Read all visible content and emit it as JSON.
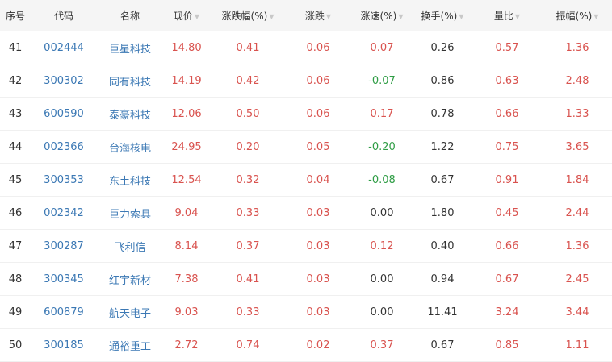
{
  "colors": {
    "up": "#d9534f",
    "down": "#2f9d45",
    "flat": "#333333",
    "link": "#3b78b4"
  },
  "headers": [
    {
      "key": "seq",
      "label": "序号",
      "sortable": false
    },
    {
      "key": "code",
      "label": "代码",
      "sortable": false
    },
    {
      "key": "name",
      "label": "名称",
      "sortable": false
    },
    {
      "key": "price",
      "label": "现价",
      "sortable": true
    },
    {
      "key": "chg_pct",
      "label": "涨跌幅(%)",
      "sortable": true
    },
    {
      "key": "chg",
      "label": "涨跌",
      "sortable": true
    },
    {
      "key": "speed",
      "label": "涨速(%)",
      "sortable": true
    },
    {
      "key": "turnover",
      "label": "换手(%)",
      "sortable": true
    },
    {
      "key": "vol_ratio",
      "label": "量比",
      "sortable": true
    },
    {
      "key": "amplitude",
      "label": "振幅(%)",
      "sortable": true
    }
  ],
  "rows": [
    {
      "seq": "41",
      "code": "002444",
      "name": "巨星科技",
      "price": "14.80",
      "chg_pct": "0.41",
      "chg": "0.06",
      "speed": "0.07",
      "turnover": "0.26",
      "vol_ratio": "0.57",
      "amplitude": "1.36"
    },
    {
      "seq": "42",
      "code": "300302",
      "name": "同有科技",
      "price": "14.19",
      "chg_pct": "0.42",
      "chg": "0.06",
      "speed": "-0.07",
      "turnover": "0.86",
      "vol_ratio": "0.63",
      "amplitude": "2.48"
    },
    {
      "seq": "43",
      "code": "600590",
      "name": "泰豪科技",
      "price": "12.06",
      "chg_pct": "0.50",
      "chg": "0.06",
      "speed": "0.17",
      "turnover": "0.78",
      "vol_ratio": "0.66",
      "amplitude": "1.33"
    },
    {
      "seq": "44",
      "code": "002366",
      "name": "台海核电",
      "price": "24.95",
      "chg_pct": "0.20",
      "chg": "0.05",
      "speed": "-0.20",
      "turnover": "1.22",
      "vol_ratio": "0.75",
      "amplitude": "3.65"
    },
    {
      "seq": "45",
      "code": "300353",
      "name": "东土科技",
      "price": "12.54",
      "chg_pct": "0.32",
      "chg": "0.04",
      "speed": "-0.08",
      "turnover": "0.67",
      "vol_ratio": "0.91",
      "amplitude": "1.84"
    },
    {
      "seq": "46",
      "code": "002342",
      "name": "巨力索具",
      "price": "9.04",
      "chg_pct": "0.33",
      "chg": "0.03",
      "speed": "0.00",
      "turnover": "1.80",
      "vol_ratio": "0.45",
      "amplitude": "2.44"
    },
    {
      "seq": "47",
      "code": "300287",
      "name": "飞利信",
      "price": "8.14",
      "chg_pct": "0.37",
      "chg": "0.03",
      "speed": "0.12",
      "turnover": "0.40",
      "vol_ratio": "0.66",
      "amplitude": "1.36"
    },
    {
      "seq": "48",
      "code": "300345",
      "name": "红宇新材",
      "price": "7.38",
      "chg_pct": "0.41",
      "chg": "0.03",
      "speed": "0.00",
      "turnover": "0.94",
      "vol_ratio": "0.67",
      "amplitude": "2.45"
    },
    {
      "seq": "49",
      "code": "600879",
      "name": "航天电子",
      "price": "9.03",
      "chg_pct": "0.33",
      "chg": "0.03",
      "speed": "0.00",
      "turnover": "11.41",
      "vol_ratio": "3.24",
      "amplitude": "3.44"
    },
    {
      "seq": "50",
      "code": "300185",
      "name": "通裕重工",
      "price": "2.72",
      "chg_pct": "0.74",
      "chg": "0.02",
      "speed": "0.37",
      "turnover": "0.67",
      "vol_ratio": "0.85",
      "amplitude": "1.11"
    }
  ]
}
